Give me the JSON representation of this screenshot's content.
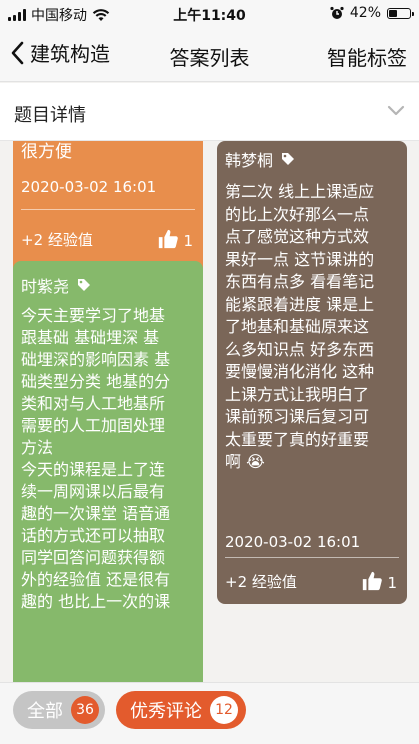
{
  "status_bar": {
    "carrier": "中国移动",
    "time": "上午11:40",
    "battery": "42%",
    "battery_level": 0.42
  },
  "nav": {
    "back_label": "建筑构造",
    "title": "答案列表",
    "right_label": "智能标签"
  },
  "detail": {
    "label": "题目详情"
  },
  "cards": [
    {
      "body": "很方便",
      "time": "2020-03-02 16:01",
      "exp": "+2 经验值",
      "likes": "1",
      "color": "#e88e4c"
    },
    {
      "author": "时紫尧",
      "body_lines": [
        "今天主要学习了地基",
        "跟基础 基础埋深 基",
        "础埋深的影响因素 基",
        "础类型分类 地基的分",
        "类和对与人工地基所",
        "需要的人工加固处理",
        "方法",
        "今天的课程是上了连",
        "续一周网课以后最有",
        "趣的一次课堂 语音通",
        "话的方式还可以抽取",
        "同学回答问题获得额",
        "外的经验值 还是很有",
        "趣的 也比上一次的课"
      ],
      "color": "#86b96b"
    },
    {
      "author": "韩梦桐",
      "body_lines": [
        "第二次 线上上课适应",
        "的比上次好那么一点",
        "点了感觉这种方式效",
        "果好一点 这节课讲的",
        "东西有点多 看看笔记",
        "能紧跟着进度 课是上",
        "了地基和基础原来这",
        "么多知识点 好多东西",
        "要慢慢消化消化 这种",
        "上课方式让我明白了",
        "课前预习课后复习可",
        "太重要了真的好重要",
        "啊 😭"
      ],
      "time": "2020-03-02 16:01",
      "exp": "+2 经验值",
      "likes": "1",
      "color": "#7a6658"
    }
  ],
  "bottom": {
    "all_label": "全部",
    "all_count": "36",
    "excellent_label": "优秀评论",
    "excellent_count": "12"
  }
}
